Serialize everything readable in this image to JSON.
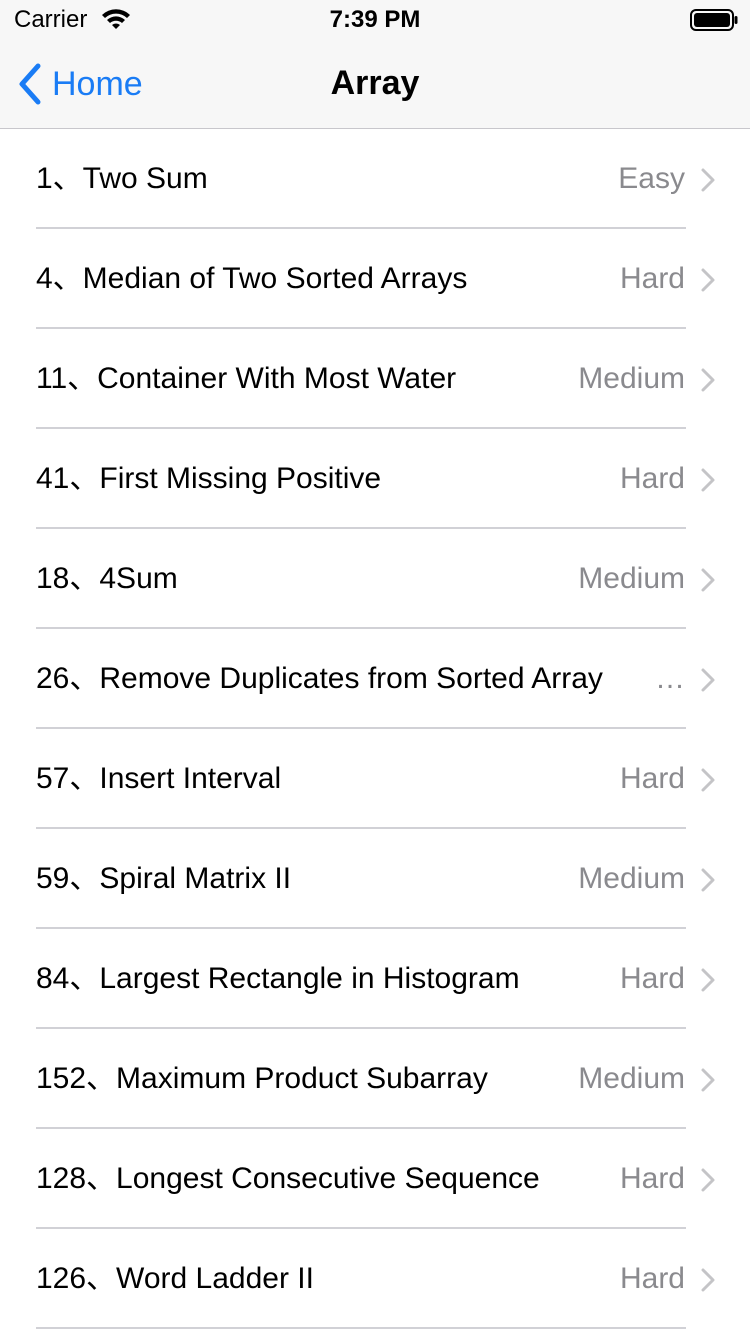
{
  "status_bar": {
    "carrier": "Carrier",
    "time": "7:39 PM"
  },
  "nav": {
    "back_label": "Home",
    "title": "Array",
    "accent_color": "#1a7cf5"
  },
  "list": {
    "items": [
      {
        "title": "1、Two Sum",
        "difficulty": "Easy"
      },
      {
        "title": "4、Median of Two Sorted Arrays",
        "difficulty": "Hard"
      },
      {
        "title": "11、Container With Most Water",
        "difficulty": "Medium"
      },
      {
        "title": "41、First Missing Positive",
        "difficulty": "Hard"
      },
      {
        "title": "18、4Sum",
        "difficulty": "Medium"
      },
      {
        "title": "26、Remove Duplicates from Sorted Array",
        "difficulty": "…"
      },
      {
        "title": "57、Insert Interval",
        "difficulty": "Hard"
      },
      {
        "title": "59、Spiral Matrix II",
        "difficulty": "Medium"
      },
      {
        "title": "84、Largest Rectangle in Histogram",
        "difficulty": "Hard"
      },
      {
        "title": "152、Maximum Product Subarray",
        "difficulty": "Medium"
      },
      {
        "title": "128、Longest Consecutive Sequence",
        "difficulty": "Hard"
      },
      {
        "title": "126、Word Ladder II",
        "difficulty": "Hard"
      }
    ]
  },
  "icons": {
    "wifi": "wifi-icon",
    "battery": "battery-icon",
    "back": "chevron-left-icon",
    "disclosure": "chevron-right-icon"
  }
}
